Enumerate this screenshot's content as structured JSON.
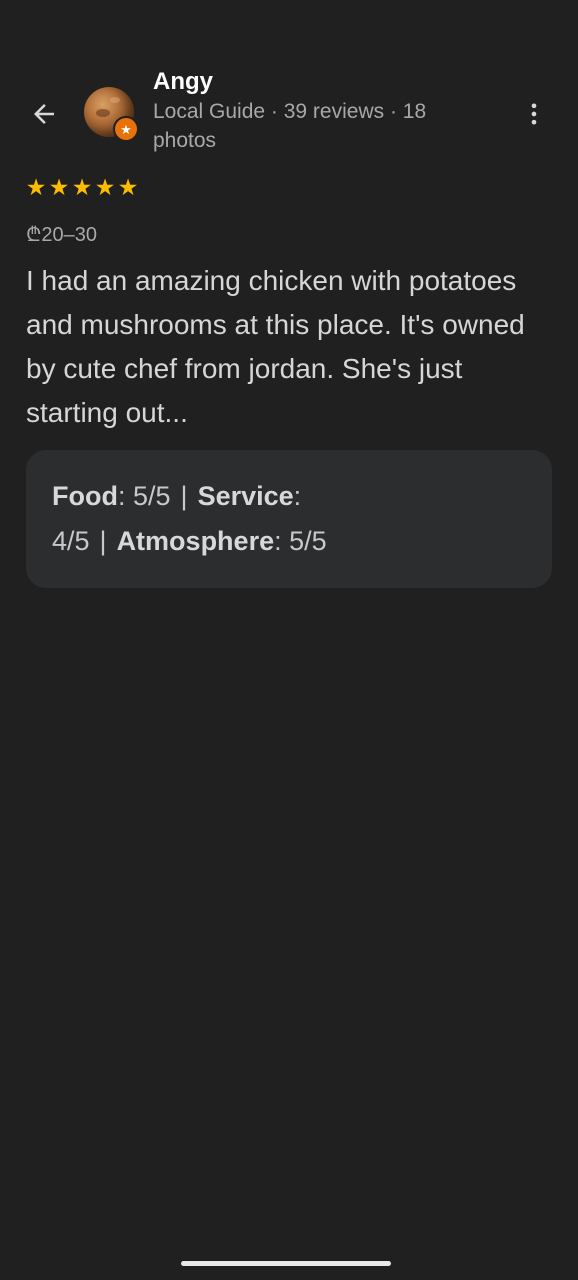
{
  "header": {
    "back_icon": "arrow-back-icon",
    "more_icon": "more-vert-icon"
  },
  "user": {
    "name": "Angy",
    "meta": "Local Guide · 39 reviews · 18 photos",
    "avatar_icon": "avatar-image",
    "badge_icon": "local-guide-star-icon",
    "badge_color": "#e8710a"
  },
  "review": {
    "stars": 5,
    "star_color": "#fbbc04",
    "price": "₾20–30",
    "text": "I had an amazing chicken with potatoes and mushrooms at this place. It's owned by cute chef from jordan. She's just starting out..."
  },
  "ratings": {
    "food_label": "Food",
    "food_value": "5/5",
    "service_label": "Service",
    "service_value": "4/5",
    "atmosphere_label": "Atmosphere",
    "atmosphere_value": "5/5",
    "separator": "|"
  }
}
